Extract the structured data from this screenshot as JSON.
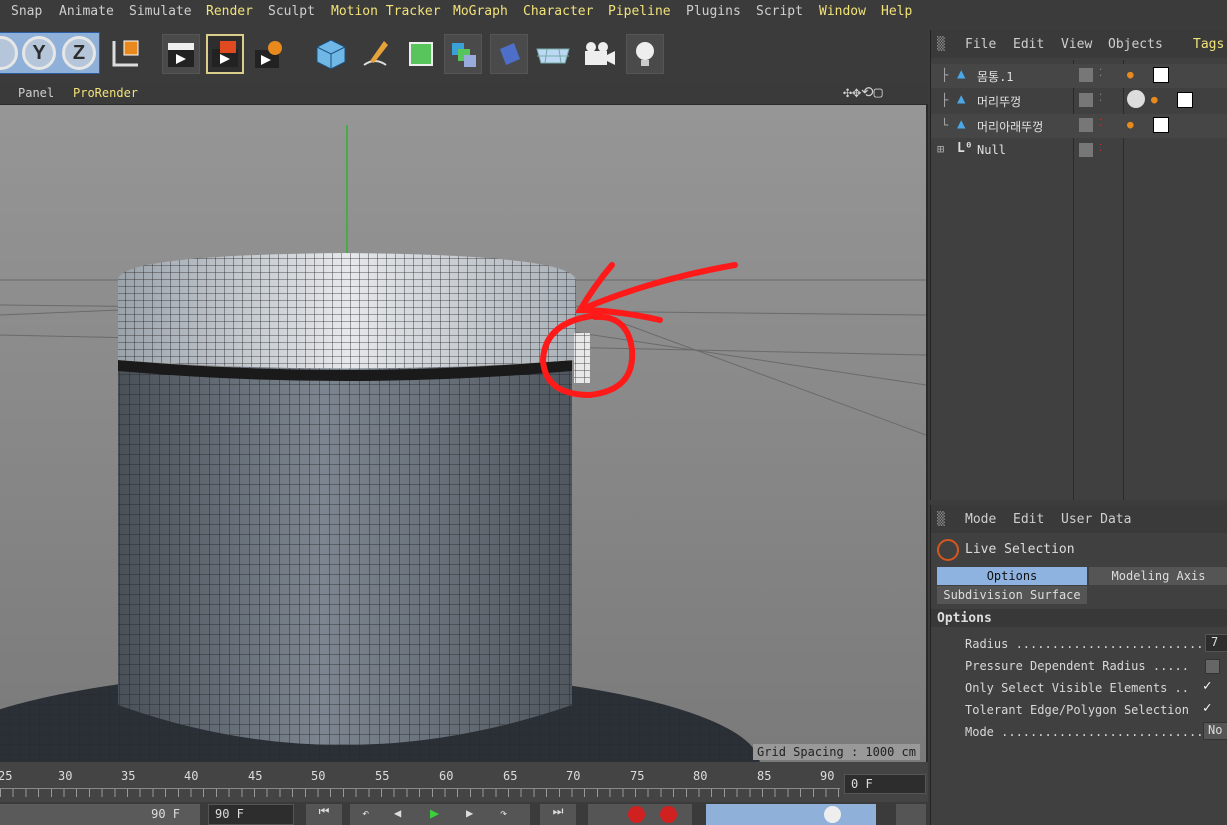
{
  "menubar": [
    "Snap",
    "Animate",
    "Simulate",
    "Render",
    "Sculpt",
    "Motion Tracker",
    "MoGraph",
    "Character",
    "Pipeline",
    "Plugins",
    "Script",
    "Window",
    "Help"
  ],
  "menubar_highlight": [
    "Render",
    "Motion Tracker",
    "MoGraph",
    "Character",
    "Pipeline",
    "Window",
    "Help"
  ],
  "toolbar": {
    "axes": [
      "Y",
      "Z"
    ]
  },
  "viewport_header": {
    "panel_label": "Panel",
    "prorender_label": "ProRender"
  },
  "viewport": {
    "grid_spacing": "Grid Spacing : 1000 cm"
  },
  "timeline": {
    "ticks": [
      "25",
      "30",
      "35",
      "40",
      "45",
      "50",
      "55",
      "60",
      "65",
      "70",
      "75",
      "80",
      "85",
      "90"
    ],
    "current_frame": "0 F"
  },
  "transport": {
    "end_frame_left": "90 F",
    "end_frame_right": "90 F"
  },
  "object_manager": {
    "menu": [
      "File",
      "Edit",
      "View",
      "Objects",
      "Tags"
    ],
    "objects": [
      {
        "name": "몸통.1"
      },
      {
        "name": "머리뚜껑"
      },
      {
        "name": "머리아래뚜껑"
      },
      {
        "name": "Null"
      }
    ]
  },
  "attribute_manager": {
    "menu": [
      "Mode",
      "Edit",
      "User Data"
    ],
    "tool_name": "Live Selection",
    "tabs": [
      "Options",
      "Modeling Axis"
    ],
    "subtab": "Subdivision Surface",
    "section": "Options",
    "fields": [
      {
        "label": "Radius ............................",
        "value": "7"
      },
      {
        "label": "Pressure Dependent Radius .....",
        "value": ""
      },
      {
        "label": "Only Select Visible Elements ..",
        "value": "✓"
      },
      {
        "label": "Tolerant Edge/Polygon Selection",
        "value": "✓"
      },
      {
        "label": "Mode ............................",
        "value": "No"
      }
    ]
  },
  "colors": {
    "highlight_yellow": "#f2e27a",
    "annotation_red": "#ff1a1a",
    "tab_active": "#8fb3e0"
  }
}
